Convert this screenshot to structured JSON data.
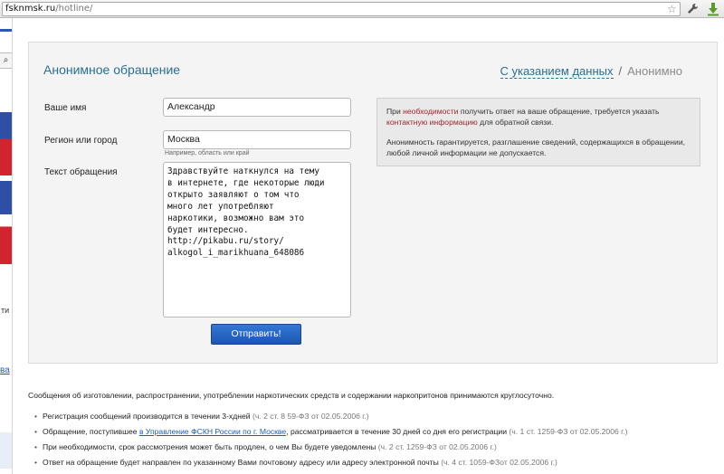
{
  "browser": {
    "url_host": "fsknmsk.ru",
    "url_path": "/hotline/"
  },
  "form": {
    "title": "Анонимное обращение",
    "mode_with_data": "С указанием данных",
    "mode_separator": "/",
    "mode_anonymous": "Анонимно",
    "name_label": "Ваше имя",
    "name_value": "Александр",
    "region_label": "Регион или город",
    "region_value": "Москва",
    "region_hint": "Например, область или край",
    "message_label": "Текст обращения",
    "message_text": "Здравствуйте наткнулся на тему\nв интернете, где некоторые люди\nоткрыто заявляют о том что\nмного лет употребляют\nнаркотики, возможно вам это\nбудет интересно.\nhttp://pikabu.ru/story/\nalkogol_i_marikhuana_648086",
    "submit_label": "Отправить!"
  },
  "info": {
    "p1_a": "При ",
    "p1_red1": "необходимости",
    "p1_b": " получить ответ на ваше обращение, требуется указать ",
    "p1_red2": "контактную информацию",
    "p1_c": " для обратной связи.",
    "p2": "Анонимность гарантируется, разглашение сведений, содержащихся в обращении, любой личной информации не допускается."
  },
  "footer": {
    "notice": "Сообщения об изготовлении, распространении, употреблении наркотических средств и содержании наркопритонов принимаются круглосуточно.",
    "item1_text": "Регистрация сообщений производится в течении 3-хдней ",
    "item1_ref": "(ч. 2 ст. 8 59-ФЗ от 02.05.2006 г.)",
    "item2_a": "Обращение, поступившее ",
    "item2_link": "в Управление ФСКН России по г. Москве",
    "item2_b": ", рассматривается в течение 30 дней со дня его регистрации ",
    "item2_ref": "(ч. 1 ст. 1259-ФЗ от 02.05.2006 г.)",
    "item3_text": "При необходимости, срок рассмотрения может быть продлен, о чем Вы будете уведомлены ",
    "item3_ref": "(ч. 2 ст. 1259-ФЗ от 02.05.2006 г.)",
    "item4_text": "Ответ на обращение будет направлен по указанному Вами почтовому адресу или адресу электронной почты ",
    "item4_ref": "(ч. 4 ст. 1059-ФЗот 02.05.2006 г.)"
  },
  "sidebar": {
    "fragment1": "ти",
    "fragment2": "ва"
  }
}
